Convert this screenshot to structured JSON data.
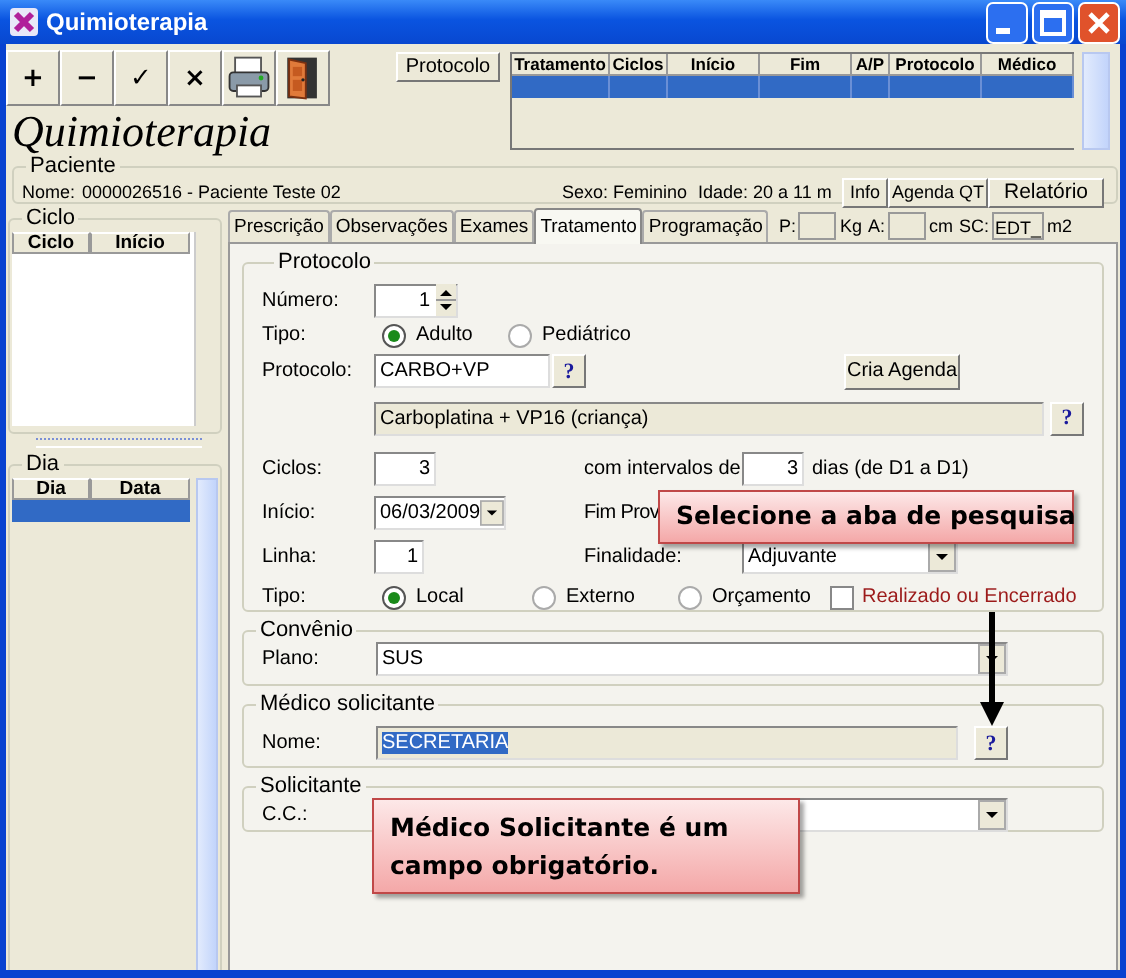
{
  "window": {
    "title": "Quimioterapia"
  },
  "toolbar": [
    {
      "kind": "text",
      "label": "+"
    },
    {
      "kind": "text",
      "label": "−"
    },
    {
      "kind": "text",
      "label": "✓"
    },
    {
      "kind": "text",
      "label": "×"
    },
    {
      "kind": "printer"
    },
    {
      "kind": "door"
    }
  ],
  "protocolo_button": "Protocolo",
  "heading": "Quimioterapia",
  "treatment_table": {
    "columns": [
      "Tratamento",
      "Ciclos",
      "Início",
      "Fim",
      "A/P",
      "Protocolo",
      "Médico"
    ],
    "rows": [
      {
        "selected": true
      }
    ]
  },
  "paciente": {
    "legend": "Paciente",
    "nome_label": "Nome:",
    "nome": "0000026516 - Paciente Teste 02",
    "sexo": "Sexo: Feminino",
    "idade": "Idade: 20 a 11 m",
    "buttons": [
      "Info",
      "Agenda QT",
      "Relatório"
    ]
  },
  "ciclo": {
    "legend": "Ciclo",
    "columns": [
      "Ciclo",
      "Início"
    ]
  },
  "dia": {
    "legend": "Dia",
    "columns": [
      "Dia",
      "Data"
    ],
    "rows": [
      {
        "selected": true
      }
    ]
  },
  "tabs": [
    {
      "label": "Prescrição",
      "selected": false
    },
    {
      "label": "Observações",
      "selected": false
    },
    {
      "label": "Exames",
      "selected": false
    },
    {
      "label": "Tratamento",
      "selected": true
    },
    {
      "label": "Programação",
      "selected": false
    }
  ],
  "measures": [
    {
      "label": "P:",
      "unit": "Kg"
    },
    {
      "label": "A:",
      "unit": "cm"
    },
    {
      "label": "SC:",
      "value": "EDT_",
      "unit": "m2"
    }
  ],
  "protocolo": {
    "legend": "Protocolo",
    "numero": {
      "label": "Número:",
      "value": "1"
    },
    "tipo": {
      "label": "Tipo:",
      "options": [
        {
          "label": "Adulto",
          "selected": true
        },
        {
          "label": "Pediátrico",
          "selected": false
        }
      ]
    },
    "protocolo": {
      "label": "Protocolo:",
      "value": "CARBO+VP",
      "help": "?"
    },
    "cria_agenda": "Cria Agenda",
    "descricao": {
      "value": "Carboplatina + VP16 (criança)",
      "help": "?"
    },
    "ciclos": {
      "label": "Ciclos:",
      "value": "3"
    },
    "intervalo": {
      "label": "com intervalos de",
      "value": "3",
      "suffix": "dias (de D1 a D1)"
    },
    "inicio": {
      "label": "Início:",
      "value": "06/03/2009"
    },
    "fim_prov_label": "Fim Prov",
    "linha": {
      "label": "Linha:",
      "value": "1"
    },
    "finalidade": {
      "label": "Finalidade:",
      "value": "Adjuvante"
    },
    "tipo2": {
      "label": "Tipo:",
      "options": [
        {
          "label": "Local",
          "selected": true
        },
        {
          "label": "Externo",
          "selected": false
        },
        {
          "label": "Orçamento",
          "selected": false
        }
      ]
    },
    "realizado": {
      "label": "Realizado ou Encerrado",
      "checked": false
    }
  },
  "convenio": {
    "legend": "Convênio",
    "label": "Plano:",
    "value": "SUS"
  },
  "medico": {
    "legend": "Médico solicitante",
    "label": "Nome:",
    "value": "SECRETARIA",
    "help": "?"
  },
  "solicitante": {
    "legend": "Solicitante",
    "label": "C.C.:"
  },
  "callouts": [
    {
      "text": "Selecione a aba de pesquisa"
    },
    {
      "text": "Médico Solicitante é um campo obrigatório."
    }
  ]
}
